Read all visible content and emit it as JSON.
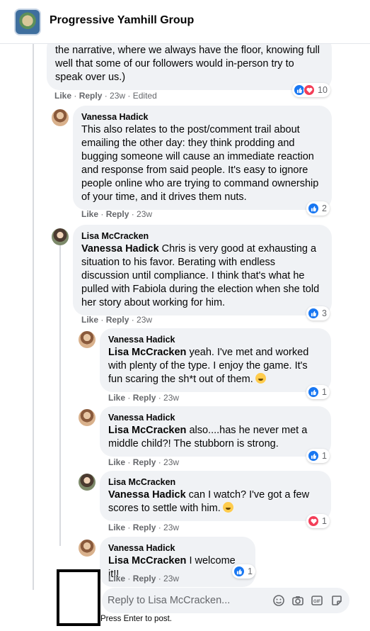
{
  "header": {
    "group_name": "Progressive Yamhill Group"
  },
  "comments": [
    {
      "text": "the narrative, where we always have the floor, knowing full well that some of our followers would in-person try to speak over us.)",
      "actions": {
        "like": "Like",
        "reply": "Reply",
        "time": "23w",
        "edited": "Edited"
      },
      "reactions": {
        "count": "10",
        "types": [
          "like",
          "love"
        ]
      }
    },
    {
      "author": "Vanessa Hadick",
      "text": "This also relates to the post/comment trail about emailing the other day: they think prodding and bugging someone will cause an immediate reaction and response from said people. It's easy to ignore people online who are trying to command ownership of your time, and it drives them nuts.",
      "actions": {
        "like": "Like",
        "reply": "Reply",
        "time": "23w"
      },
      "reactions": {
        "count": "2",
        "types": [
          "like"
        ]
      }
    },
    {
      "author": "Lisa McCracken",
      "mention": "Vanessa Hadick",
      "text": " Chris is very good at exhausting a situation to his favor. Berating with endless discussion until compliance. I think that's what he pulled with Fabiola during the election when she told her story about working for him.",
      "actions": {
        "like": "Like",
        "reply": "Reply",
        "time": "23w"
      },
      "reactions": {
        "count": "3",
        "types": [
          "like"
        ]
      }
    }
  ],
  "replies": [
    {
      "author": "Vanessa Hadick",
      "mention": "Lisa McCracken",
      "text": " yeah. I've met and worked with plenty of the type. I enjoy the game. It's fun scaring the sh*t out of them.",
      "emoji": "laughing-emoji",
      "actions": {
        "like": "Like",
        "reply": "Reply",
        "time": "23w"
      },
      "reactions": {
        "count": "1",
        "types": [
          "like"
        ]
      }
    },
    {
      "author": "Vanessa Hadick",
      "mention": "Lisa McCracken",
      "text": " also....has he never met a middle child?! The stubborn is strong.",
      "actions": {
        "like": "Like",
        "reply": "Reply",
        "time": "23w"
      },
      "reactions": {
        "count": "1",
        "types": [
          "like"
        ]
      }
    },
    {
      "author": "Lisa McCracken",
      "mention": "Vanessa Hadick",
      "text": " can I watch? I've got a few scores to settle with him.",
      "emoji": "winking-emoji",
      "actions": {
        "like": "Like",
        "reply": "Reply",
        "time": "23w"
      },
      "reactions": {
        "count": "1",
        "types": [
          "love"
        ]
      }
    },
    {
      "author": "Vanessa Hadick",
      "mention": "Lisa McCracken",
      "text": " I welcome it!!",
      "actions": {
        "like": "Like",
        "reply": "Reply",
        "time": "23w"
      },
      "reactions": {
        "count": "1",
        "types": [
          "like"
        ]
      }
    }
  ],
  "reply_box": {
    "placeholder": "Reply to Lisa McCracken...",
    "hint": "Press Enter to post.",
    "tools": [
      "emoji-icon",
      "camera-icon",
      "gif-icon",
      "sticker-icon"
    ]
  },
  "colors": {
    "like_blue": "#1877f2",
    "love_red": "#f33e58",
    "bubble_bg": "#f0f2f5",
    "meta_gray": "#65676b"
  }
}
